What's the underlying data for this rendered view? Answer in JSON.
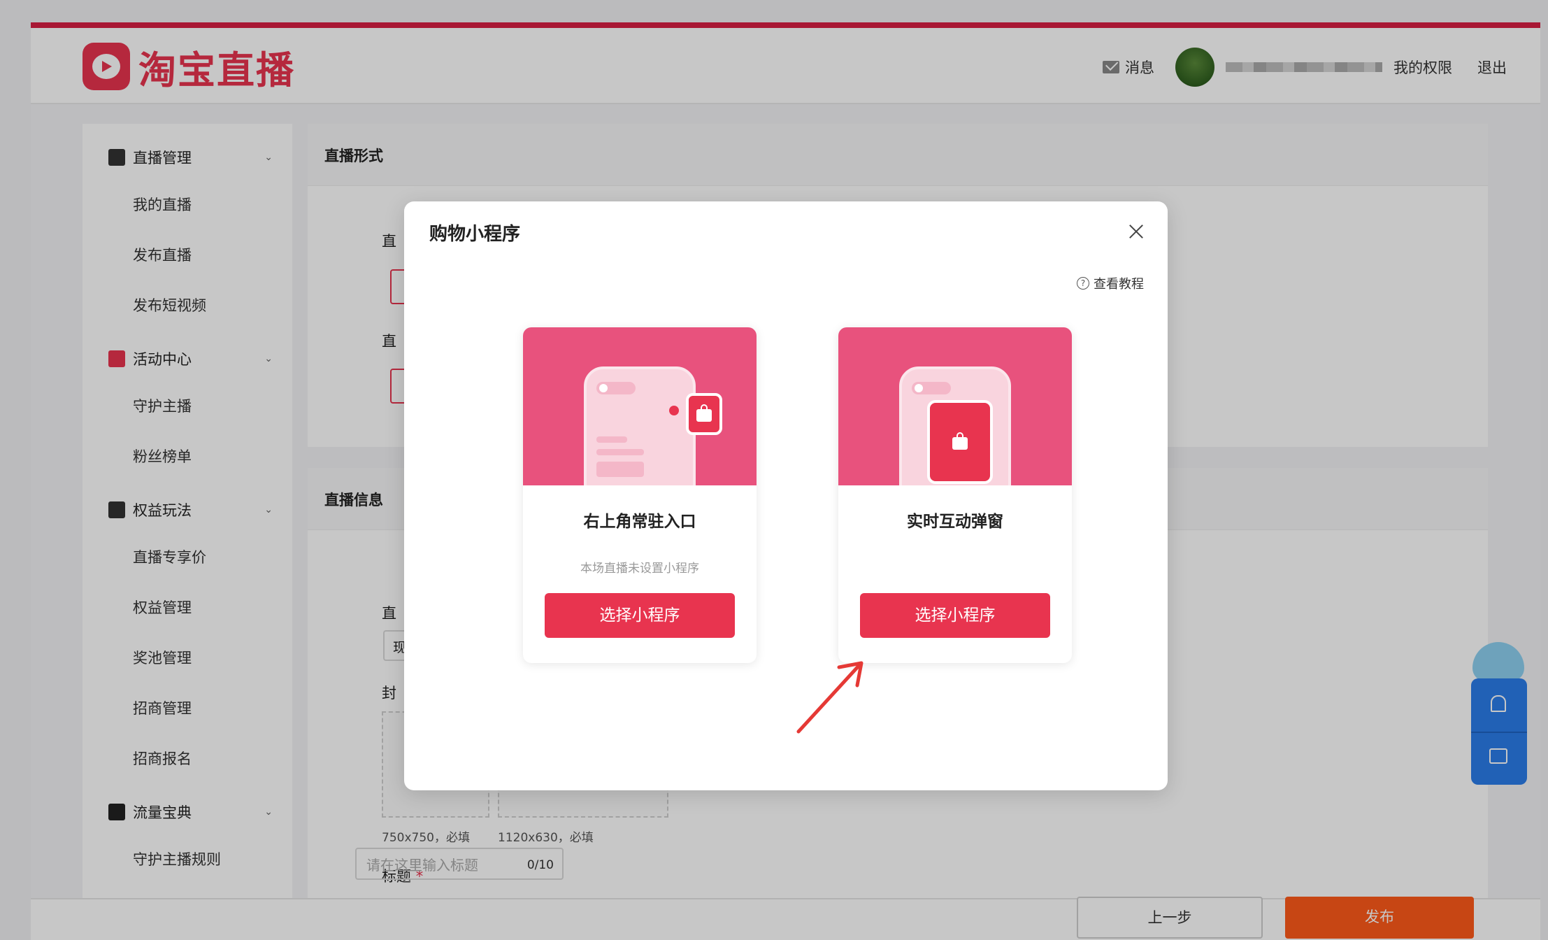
{
  "brand": {
    "logo_text": "淘宝直播",
    "accent": "#e8344f"
  },
  "header": {
    "messages_label": "消息",
    "username": "",
    "permissions_label": "我的权限",
    "logout_label": "退出"
  },
  "sidebar": {
    "groups": [
      {
        "label": "直播管理",
        "icon": "document-icon",
        "items": [
          "我的直播",
          "发布直播",
          "发布短视频"
        ]
      },
      {
        "label": "活动中心",
        "icon": "flag-icon",
        "items": [
          "守护主播",
          "粉丝榜单"
        ]
      },
      {
        "label": "权益玩法",
        "icon": "gift-icon",
        "items": [
          "直播专享价",
          "权益管理",
          "奖池管理",
          "招商管理",
          "招商报名"
        ]
      },
      {
        "label": "流量宝典",
        "icon": "trend-icon",
        "items": [
          "守护主播规则"
        ]
      }
    ]
  },
  "form": {
    "section1_title": "直播形式",
    "section2_title": "直播信息",
    "frag_a": "直",
    "frag_b": "直",
    "frag_c": "直",
    "frag_d": "封",
    "frag_e": "现",
    "cover_hint_1": "750x750，必填",
    "cover_hint_2": "1120x630，必填",
    "title_label": "标题",
    "title_required": "*",
    "title_placeholder": "请在这里输入标题",
    "title_count": "0/10"
  },
  "footer": {
    "prev_label": "上一步",
    "publish_label": "发布",
    "publish_color": "#ff5a1a"
  },
  "modal": {
    "title": "购物小程序",
    "tutorial_label": "查看教程",
    "cards": [
      {
        "title": "右上角常驻入口",
        "subtitle": "本场直播未设置小程序",
        "button": "选择小程序"
      },
      {
        "title": "实时互动弹窗",
        "subtitle": "",
        "button": "选择小程序"
      }
    ]
  },
  "annotation": {
    "arrow_color": "#e53935"
  }
}
